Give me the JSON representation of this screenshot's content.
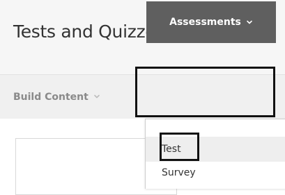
{
  "page": {
    "title": "Tests and Quizzes",
    "title_menu_icon": "chevron-down-icon"
  },
  "toolbar": {
    "build_content_label": "Build Content",
    "assessments_label": "Assessments"
  },
  "dropdown": {
    "items": [
      {
        "label": "Test"
      },
      {
        "label": "Survey"
      }
    ]
  },
  "colors": {
    "active_button_bg": "#5f5f5f",
    "highlight_border": "#111111",
    "header_bg": "#f6f6f6",
    "hover_item_bg": "#eeeeee"
  }
}
